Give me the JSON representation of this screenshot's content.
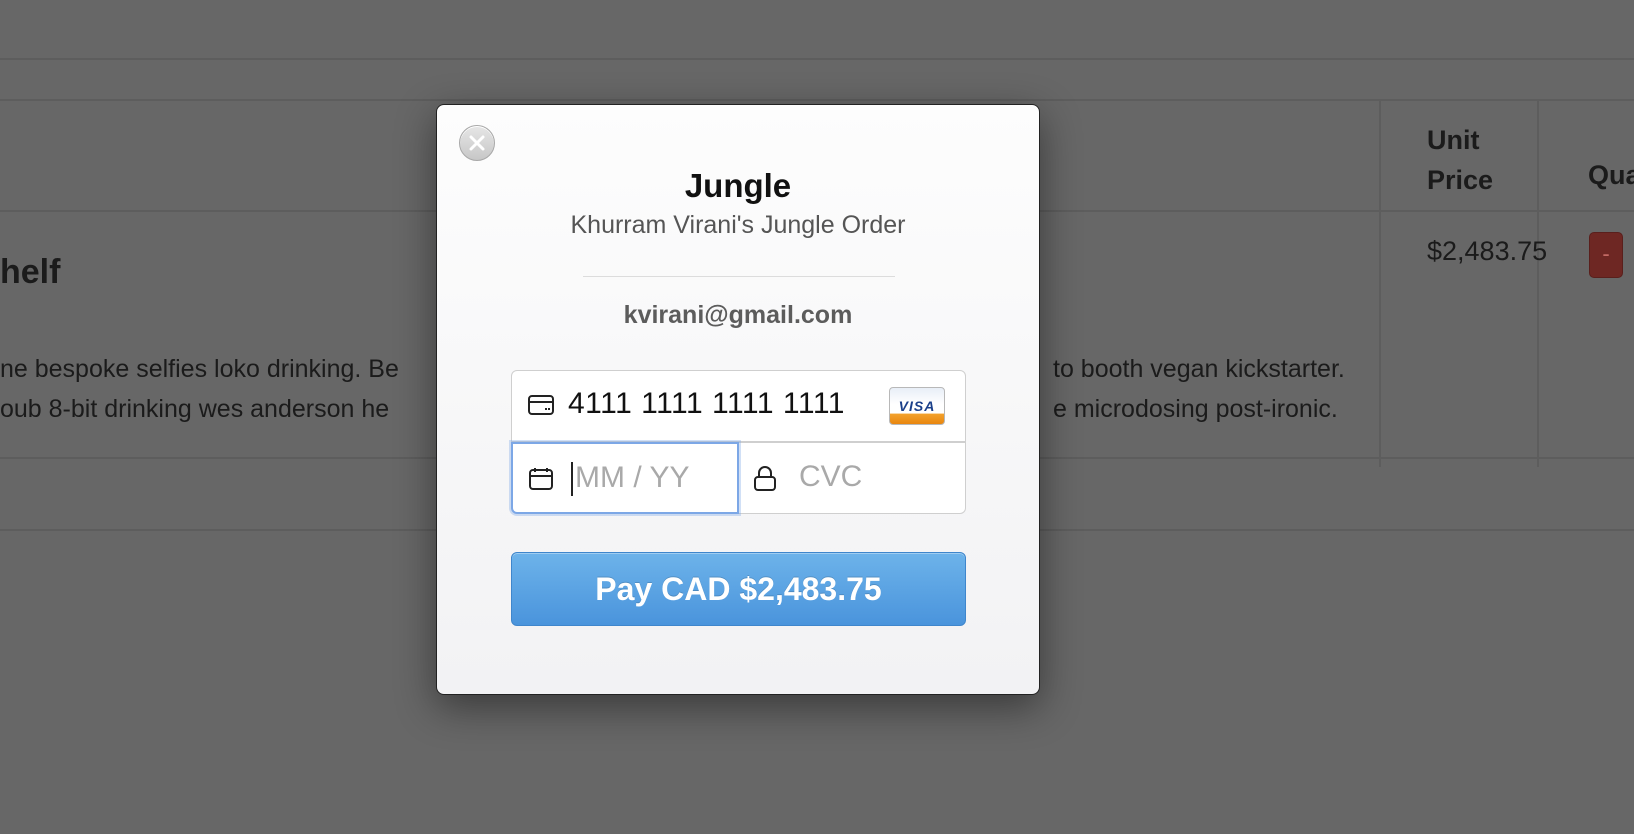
{
  "background": {
    "table_header": {
      "unit_price": "Unit\nPrice",
      "quantity": "Qua"
    },
    "product": {
      "title": "helf",
      "description_line1_left": "ne bespoke selfies loko drinking. Be",
      "description_line2_left": "oub 8-bit drinking wes anderson he",
      "description_line1_right": "to booth vegan kickstarter.",
      "description_line2_right": "e microdosing post-ironic.",
      "unit_price": "$2,483.75",
      "decrement_label": "-"
    }
  },
  "modal": {
    "close_icon": "close-icon",
    "title": "Jungle",
    "subtitle": "Khurram Virani's Jungle Order",
    "email": "kvirani@gmail.com",
    "card_number": "4111 1111 1111 1111",
    "card_brand": "VISA",
    "expiry_placeholder": "MM / YY",
    "cvc_placeholder": "CVC",
    "pay_label": "Pay CAD $2,483.75",
    "accent_color": "#4a94dc"
  }
}
